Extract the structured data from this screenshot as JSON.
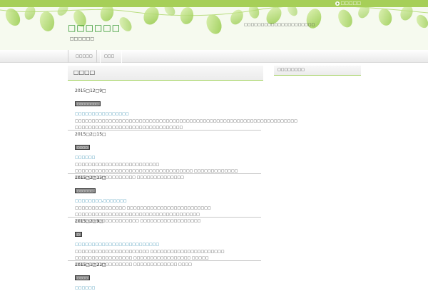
{
  "header": {
    "site_title": "□□□□□□",
    "site_description": "□□□□□□",
    "message": "□□□□□□□□□□□□□□□□□□□□□",
    "top_link": "□□□□□"
  },
  "nav": {
    "items": [
      {
        "label": "□□□□□"
      },
      {
        "label": "□□□"
      }
    ]
  },
  "main": {
    "heading": "□□□□",
    "posts": [
      {
        "date": "2015□12□9□",
        "category": "□□□□□□□□",
        "title": "□□□□□□□□□□□□□□□□",
        "excerpt": "□□□□□□□□□□□□□□□□□□□□□□□□□□□□□□□□□□□□□□□□□□□□□□□□□□□□□□□□□□□□□□□□□□ □□□□□□□□□□□□□□□□□□□□□□□□□□□□□□□□"
      },
      {
        "date": "2015□2□15□",
        "category": "□□□□",
        "title": "□□□□□□",
        "excerpt": "□□□□□□□□□□□□□□□□□□□□□□□□□ □□□□□□□□□□□□□□□□□□□□□□□□□□□□□□□□□□□ □□□□□□□□□□□□□ □□□□□□□□□□□□□□□□□□ □□□□□□□□□□□□□□"
      },
      {
        "date": "2015□2□15□",
        "category": "□□□□□□",
        "title": "□□□□□□□□,□□□□□□□",
        "excerpt": "□□□□□□□□□□□□□□□ □□□□□□□□□□□□□□□□□□□□□□□□□ □□□□□□□□□□□□□□□□□□□□□□□□□□□□□□□□□□□□□ □□□□□□□□□□□□□□□□□□□ □□□□□□□□□□□□□□□□□□"
      },
      {
        "date": "2015□2□9□",
        "category": "□",
        "title": "□□□□□□□□□□□□□□□□□□□□□□□□□",
        "excerpt": "□□□□□□□□□□□□□□□□□□□□□□ □□□□□□□□□□□□□□□□□□□□□□ □□□□□□□□□□□□□□□□□ □□□□□□□□□□□□□□□□□ □□□□□ □□□□□□□□□□□□□□□□□ □□□□□□□□□□□□□ □□□□"
      },
      {
        "date": "2015□1□21□",
        "category": "□□□□",
        "title": "□□□□□□",
        "excerpt": ""
      }
    ]
  },
  "sidebar": {
    "heading": "□□□□□□□□"
  },
  "colors": {
    "top_bar": "#a6cf58",
    "site_title": "#1a8a16",
    "link": "#1a7fa8",
    "accent_line": "#9fcf5a"
  },
  "icons": [
    "leaf-decoration-icon",
    "arrow-bullet-icon"
  ]
}
